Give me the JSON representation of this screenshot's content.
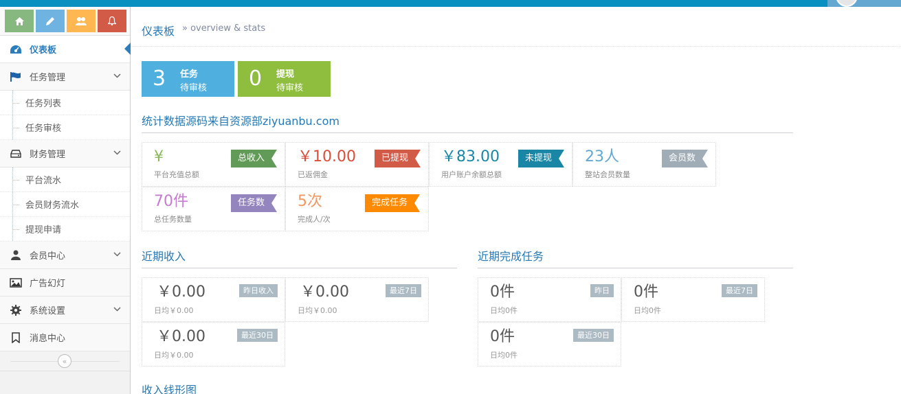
{
  "colors": {
    "topbar": "#0a8fc1",
    "accent": "#2679b5",
    "info_blue": "#4fb0e0",
    "info_green": "#8fbe3e"
  },
  "shortcuts": [
    {
      "icon": "home-icon"
    },
    {
      "icon": "pencil-icon"
    },
    {
      "icon": "users-icon"
    },
    {
      "icon": "bell-icon"
    }
  ],
  "sidebar": {
    "dashboard": "仪表板",
    "task_mgmt": "任务管理",
    "task_list": "任务列表",
    "task_review": "任务审核",
    "finance_mgmt": "财务管理",
    "platform_flow": "平台流水",
    "member_finance_flow": "会员财务流水",
    "withdraw_apply": "提现申请",
    "member_center": "会员中心",
    "ad_slides": "广告幻灯",
    "system_settings": "系统设置",
    "message_center": "消息中心",
    "collapse": "«"
  },
  "page_header": {
    "title": "仪表板",
    "subtitle": "» overview & stats"
  },
  "infoboxes": [
    {
      "number": "3",
      "line1": "任务",
      "line2": "待审核",
      "color": "#4fb0e0"
    },
    {
      "number": "0",
      "line1": "提现",
      "line2": "待审核",
      "color": "#8fbe3e"
    }
  ],
  "stats_title": "统计数据源码来自资源部ziyuanbu.com",
  "stats": [
    {
      "value": "¥",
      "label": "平台充值总额",
      "badge": "总收入",
      "value_color": "#8bb85f"
    },
    {
      "value": "￥10.00",
      "label": "已返佣金",
      "badge": "已提现",
      "value_color": "#d94d3a"
    },
    {
      "value": "￥83.00",
      "label": "用户账户余额总额",
      "badge": "未提现",
      "value_color": "#1a86a6"
    },
    {
      "value": "23人",
      "label": "整站会员数量",
      "badge": "会员数",
      "value_color": "#62a8d1"
    },
    {
      "value": "70件",
      "label": "总任务数量",
      "badge": "任务数",
      "value_color": "#c77ad1"
    },
    {
      "value": "5次",
      "label": "完成人/次",
      "badge": "完成任务",
      "value_color": "#f09863"
    }
  ],
  "income_title": "近期收入",
  "income": [
    {
      "value": "￥0.00",
      "label": "日均￥0.00",
      "tag": "昨日收入"
    },
    {
      "value": "￥0.00",
      "label": "日均￥0.00",
      "tag": "最近7日"
    },
    {
      "value": "￥0.00",
      "label": "日均￥0.00",
      "tag": "最近30日"
    }
  ],
  "tasks_title": "近期完成任务",
  "tasks": [
    {
      "value": "0件",
      "label": "日均0件",
      "tag": "昨日"
    },
    {
      "value": "0件",
      "label": "日均0件",
      "tag": "最近7日"
    },
    {
      "value": "0件",
      "label": "日均0件",
      "tag": "最近30日"
    }
  ],
  "chart_title": "收入线形图"
}
